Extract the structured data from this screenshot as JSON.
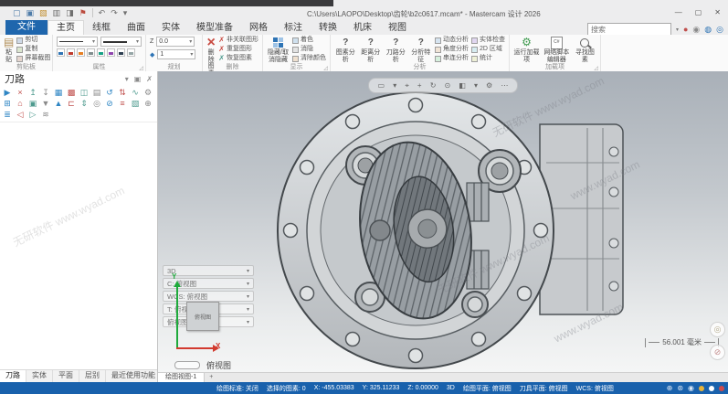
{
  "titlebar": {
    "title": "C:\\Users\\LAOPO\\Desktop\\齿轮\\b2c0617.mcam* - Mastercam 设计 2026",
    "minimize": "—",
    "maximize": "▢",
    "close": "✕",
    "qat": [
      "▢",
      "▣",
      "▧",
      "▥",
      "◨",
      "⚑",
      "↶",
      "↷",
      "▾"
    ]
  },
  "search": {
    "placeholder": "搜索",
    "caret": "▾",
    "icons": [
      "●",
      "◉",
      "◍",
      "◎"
    ]
  },
  "tabs": {
    "file": "文件",
    "items": [
      "主页",
      "线框",
      "曲面",
      "实体",
      "模型准备",
      "网格",
      "标注",
      "转换",
      "机床",
      "视图"
    ]
  },
  "ribbon": {
    "clipboard": {
      "label": "剪贴板",
      "paste": "粘贴",
      "paste_glyph": "▤",
      "small": [
        "剪切",
        "复制",
        "屏幕截图"
      ]
    },
    "attributes": {
      "label": "属性"
    },
    "organize": {
      "label": "规划",
      "z_label": "Z",
      "z_value": "0.0",
      "level_glyph": "◆",
      "level_value": "1"
    },
    "delete": {
      "label": "删除",
      "x": "×",
      "main": "删除图素",
      "small_x": "✗",
      "small": [
        "非关联图形",
        "重复图形",
        "恢复图素"
      ]
    },
    "display": {
      "label": "显示",
      "main": "隐藏/取消隐藏",
      "small": [
        "着色",
        "消隐",
        "清除颜色"
      ]
    },
    "analyze": {
      "label": "分析",
      "q": "?",
      "big": [
        "图素分析",
        "距离分析",
        "刀路分析",
        "分析特征"
      ],
      "small_a": [
        "动态分析",
        "角度分析",
        "串连分析"
      ],
      "small_b": [
        "实体检查",
        "2D 区域",
        "统计"
      ]
    },
    "addins": {
      "label": "加载项",
      "gear": "⚙",
      "csharp": "C#",
      "items": [
        "运行加载项",
        "网络脚本编辑器",
        "寻找图素"
      ]
    }
  },
  "toolpaths": {
    "title": "刀路",
    "header_icons": [
      "▾",
      "▣",
      "✗"
    ],
    "row1": [
      "▶",
      "×",
      "↥",
      "↧",
      "▦",
      "▩",
      "◫",
      "▤",
      "↺",
      "⇅",
      "∿",
      "⚙"
    ],
    "row2": [
      "⊞",
      "⌂",
      "▣",
      "▼",
      "▲",
      "⊏",
      "⇕",
      "◎",
      "⊘",
      "≡",
      "▧",
      "⊕"
    ],
    "row3": [
      "≣",
      "◁",
      "▷",
      "≋"
    ]
  },
  "panel_tabs": [
    "刀路",
    "实体",
    "平面",
    "层别",
    "最近使用功能"
  ],
  "viewport": {
    "select_bar": [
      "▭",
      "▾",
      "⌖",
      "+",
      "↻",
      "⊙",
      "◧",
      "▾",
      "⚙",
      "⋯"
    ],
    "plane_rows": [
      "3D",
      "C: 俯视图",
      "WCS: 俯视图",
      "T: 俯视图",
      "俯视图"
    ],
    "chevron": "▾",
    "axis_x": "X",
    "axis_y": "Y",
    "gnomon_label": "俯视图",
    "view_label": "俯视图",
    "scale_label": "56.001 毫米",
    "float_buttons": [
      "◎",
      "⊘"
    ]
  },
  "viewsheet": {
    "tab": "绘图视图-1",
    "add": "+"
  },
  "status": {
    "items": [
      "绘图标准: 关闭",
      "选择的图素: 0",
      "X: -455.03383",
      "Y: 325.11233",
      "Z: 0.00000",
      "3D",
      "绘图平面: 俯视图",
      "刀具平面: 俯视图",
      "WCS: 俯视图"
    ],
    "icons": [
      "⊕",
      "⊛",
      "◉"
    ]
  },
  "watermark": {
    "site": "www.wyad.com",
    "brand": "无研软件"
  },
  "colors": {
    "accent": "#1f66ad",
    "status_bar": "#1961ac",
    "delete_red": "#c84b42"
  }
}
